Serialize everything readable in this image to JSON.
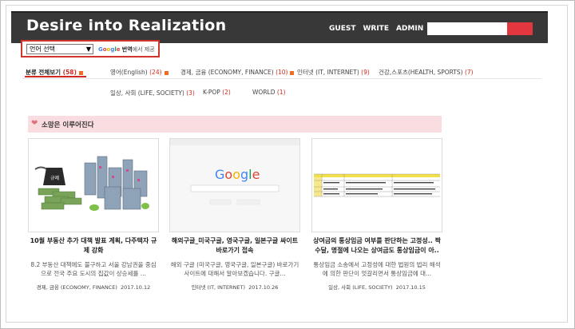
{
  "brand": "Desire into Realization",
  "nav": [
    "GUEST",
    "WRITE",
    "ADMIN"
  ],
  "translate": {
    "language_select": "언어 선택",
    "google": "Google",
    "translate_label": "번역",
    "suffix": "에서 제공"
  },
  "categories": [
    {
      "label": "분류 전체보기",
      "count": "(58)"
    },
    {
      "label": "영어(English)",
      "count": "(24)"
    },
    {
      "label": "경제, 금융 (ECONOMY, FINANCE)",
      "count": "(10)"
    },
    {
      "label": "인터넷 (IT, INTERNET)",
      "count": "(9)"
    },
    {
      "label": "건강,스포츠(HEALTH, SPORTS)",
      "count": "(7)"
    },
    {
      "label": "일상, 사회 (LIFE, SOCIETY)",
      "count": "(3)"
    },
    {
      "label": "K-POP",
      "count": "(2)"
    },
    {
      "label": "WORLD",
      "count": "(1)"
    }
  ],
  "section_title": "소망은 이루어진다",
  "posts": [
    {
      "title": "10월 부동산 추가 대책 발표 계획, 다주택자 규제 강화",
      "summary": "8.2 부동산 대책에도 불구하고 서울 강남권을 중심으로 전국 주요 도시의 집값이 상승세를 ...",
      "category": "경제, 금융 (ECONOMY, FINANCE)",
      "date": "2017.10.12",
      "thumb_label": "규제"
    },
    {
      "title": "해외구글_미국구글, 영국구글, 일본구글 싸이트 바로가기 접속",
      "summary": "해외 구글 (미국구글, 영국구글, 일본구글) 바로가기 사이트에 대해서 알아보겠습니다. 구글...",
      "category": "인터넷 (IT, INTERNET)",
      "date": "2017.10.26",
      "thumb_label": "Google"
    },
    {
      "title": "상여금의 통상임금 여부를 판단하는 고정성.. 짝수달, 명절에 나오는 상여금도 통상임금이 아..",
      "summary": "통상임금 소송에서 고정성에 대한 법원의 법리 해석에 의한 판단이 엇갈리면서 통상임금에 대...",
      "category": "일상, 사회 (LIFE, SOCIETY)",
      "date": "2017.10.15",
      "thumb_label": ""
    }
  ],
  "colors": {
    "topbar": "#383838",
    "accent_red": "#e2373f",
    "section_pink": "#fadde0"
  }
}
